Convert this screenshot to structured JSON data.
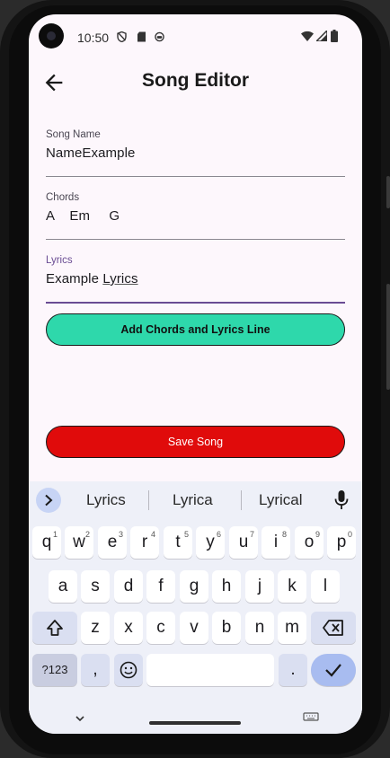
{
  "status_bar": {
    "time": "10:50"
  },
  "app_bar": {
    "title": "Song Editor"
  },
  "form": {
    "song_name": {
      "label": "Song Name",
      "value": "NameExample"
    },
    "chords": {
      "label": "Chords",
      "value": "A    Em     G"
    },
    "lyrics": {
      "label": "Lyrics",
      "value_prefix": "Example ",
      "value_underlined": "Lyrics"
    }
  },
  "buttons": {
    "add_line": "Add Chords and Lyrics Line",
    "save_song": "Save Song"
  },
  "keyboard": {
    "suggestions": [
      "Lyrics",
      "Lyrica",
      "Lyrical"
    ],
    "row1": [
      {
        "k": "q",
        "h": "1"
      },
      {
        "k": "w",
        "h": "2"
      },
      {
        "k": "e",
        "h": "3"
      },
      {
        "k": "r",
        "h": "4"
      },
      {
        "k": "t",
        "h": "5"
      },
      {
        "k": "y",
        "h": "6"
      },
      {
        "k": "u",
        "h": "7"
      },
      {
        "k": "i",
        "h": "8"
      },
      {
        "k": "o",
        "h": "9"
      },
      {
        "k": "p",
        "h": "0"
      }
    ],
    "row2": [
      "a",
      "s",
      "d",
      "f",
      "g",
      "h",
      "j",
      "k",
      "l"
    ],
    "row3": [
      "z",
      "x",
      "c",
      "v",
      "b",
      "n",
      "m"
    ],
    "symbols_label": "?123",
    "comma": ",",
    "period": "."
  },
  "colors": {
    "add_button": "#2ed8ab",
    "save_button": "#e00b0b",
    "focus_accent": "#6a4c93",
    "screen_bg": "#fdf7fc",
    "keyboard_bg": "#eef0f8"
  }
}
